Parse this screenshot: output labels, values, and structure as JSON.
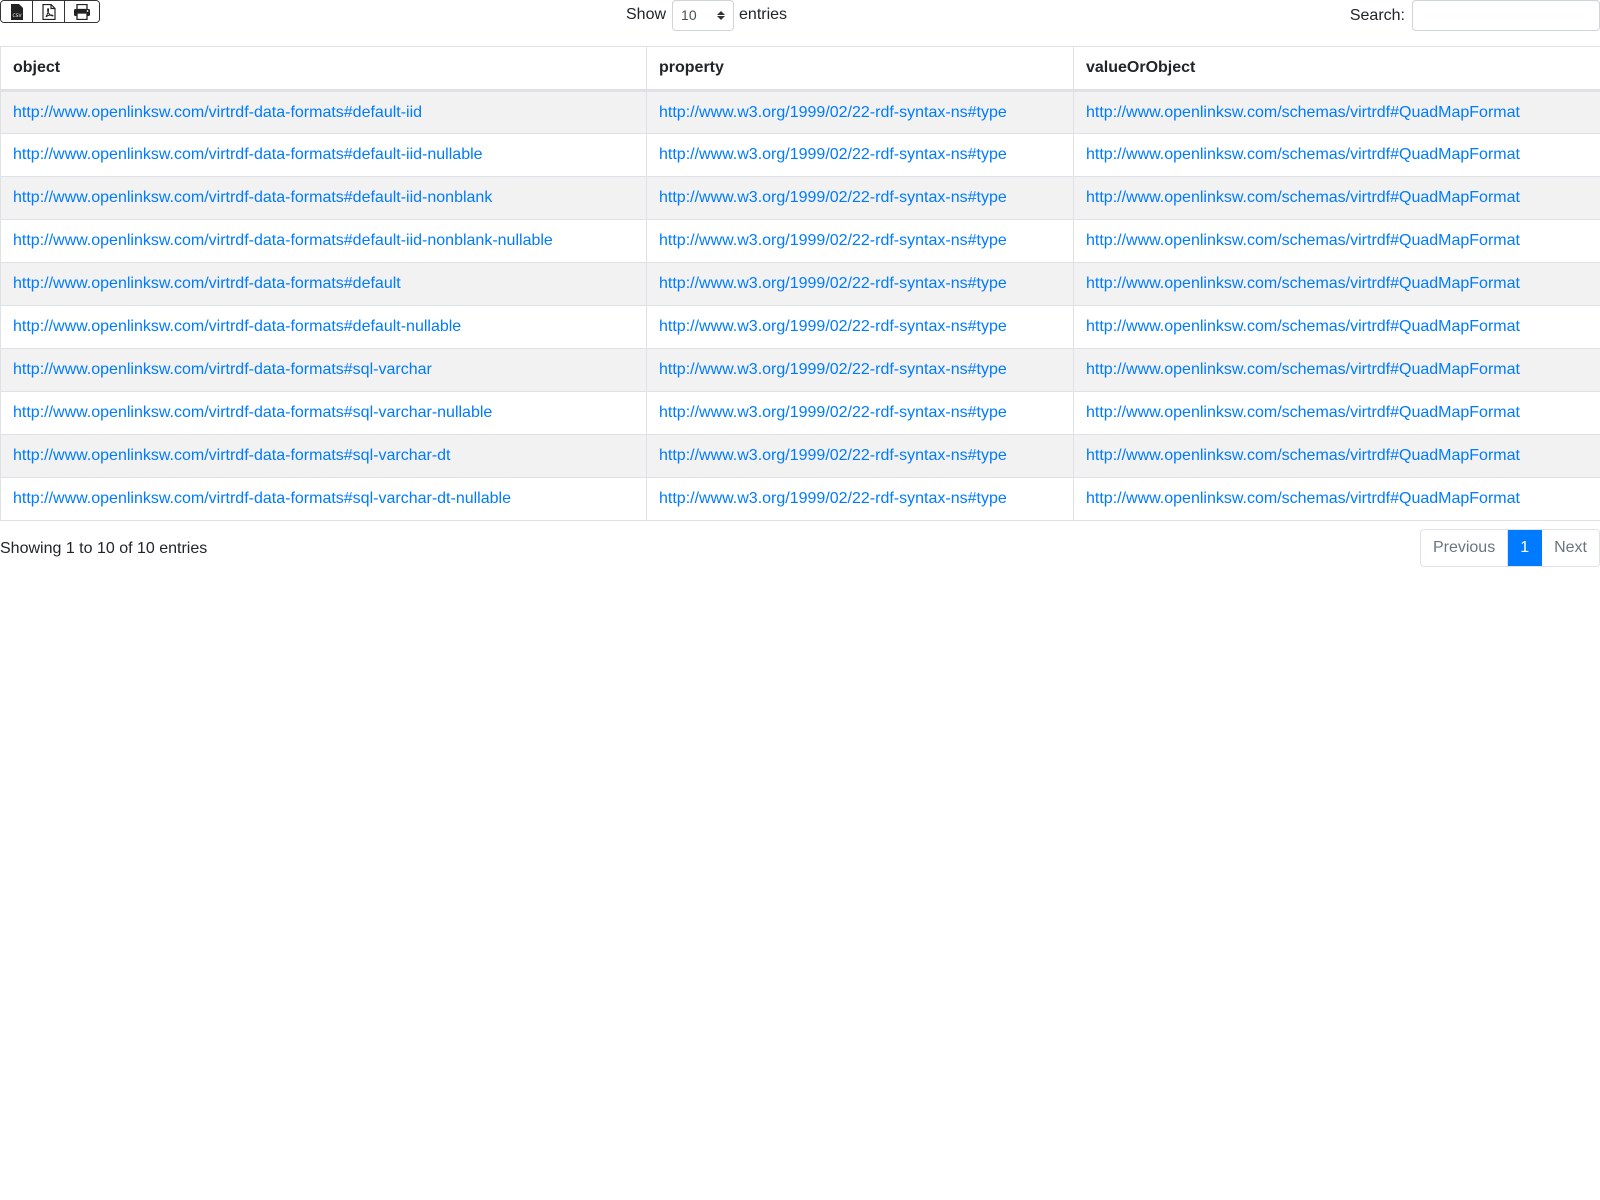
{
  "toolbar": {
    "export_buttons": [
      {
        "icon": "file-csv-icon",
        "label": "CSV"
      },
      {
        "icon": "file-pdf-icon"
      },
      {
        "icon": "print-icon"
      }
    ],
    "show_label": "Show",
    "page_length": "10",
    "entries_label": "entries",
    "search_label": "Search:",
    "search_value": ""
  },
  "table": {
    "columns": [
      "object",
      "property",
      "valueOrObject"
    ],
    "rows": [
      [
        "http://www.openlinksw.com/virtrdf-data-formats#default-iid",
        "http://www.w3.org/1999/02/22-rdf-syntax-ns#type",
        "http://www.openlinksw.com/schemas/virtrdf#QuadMapFormat"
      ],
      [
        "http://www.openlinksw.com/virtrdf-data-formats#default-iid-nullable",
        "http://www.w3.org/1999/02/22-rdf-syntax-ns#type",
        "http://www.openlinksw.com/schemas/virtrdf#QuadMapFormat"
      ],
      [
        "http://www.openlinksw.com/virtrdf-data-formats#default-iid-nonblank",
        "http://www.w3.org/1999/02/22-rdf-syntax-ns#type",
        "http://www.openlinksw.com/schemas/virtrdf#QuadMapFormat"
      ],
      [
        "http://www.openlinksw.com/virtrdf-data-formats#default-iid-nonblank-nullable",
        "http://www.w3.org/1999/02/22-rdf-syntax-ns#type",
        "http://www.openlinksw.com/schemas/virtrdf#QuadMapFormat"
      ],
      [
        "http://www.openlinksw.com/virtrdf-data-formats#default",
        "http://www.w3.org/1999/02/22-rdf-syntax-ns#type",
        "http://www.openlinksw.com/schemas/virtrdf#QuadMapFormat"
      ],
      [
        "http://www.openlinksw.com/virtrdf-data-formats#default-nullable",
        "http://www.w3.org/1999/02/22-rdf-syntax-ns#type",
        "http://www.openlinksw.com/schemas/virtrdf#QuadMapFormat"
      ],
      [
        "http://www.openlinksw.com/virtrdf-data-formats#sql-varchar",
        "http://www.w3.org/1999/02/22-rdf-syntax-ns#type",
        "http://www.openlinksw.com/schemas/virtrdf#QuadMapFormat"
      ],
      [
        "http://www.openlinksw.com/virtrdf-data-formats#sql-varchar-nullable",
        "http://www.w3.org/1999/02/22-rdf-syntax-ns#type",
        "http://www.openlinksw.com/schemas/virtrdf#QuadMapFormat"
      ],
      [
        "http://www.openlinksw.com/virtrdf-data-formats#sql-varchar-dt",
        "http://www.w3.org/1999/02/22-rdf-syntax-ns#type",
        "http://www.openlinksw.com/schemas/virtrdf#QuadMapFormat"
      ],
      [
        "http://www.openlinksw.com/virtrdf-data-formats#sql-varchar-dt-nullable",
        "http://www.w3.org/1999/02/22-rdf-syntax-ns#type",
        "http://www.openlinksw.com/schemas/virtrdf#QuadMapFormat"
      ]
    ]
  },
  "footer": {
    "info": "Showing 1 to 10 of 10 entries",
    "previous": "Previous",
    "current_page": "1",
    "next": "Next"
  },
  "colors": {
    "link": "#007bff",
    "active_page": "#007bff",
    "stripe": "#f2f2f2"
  }
}
